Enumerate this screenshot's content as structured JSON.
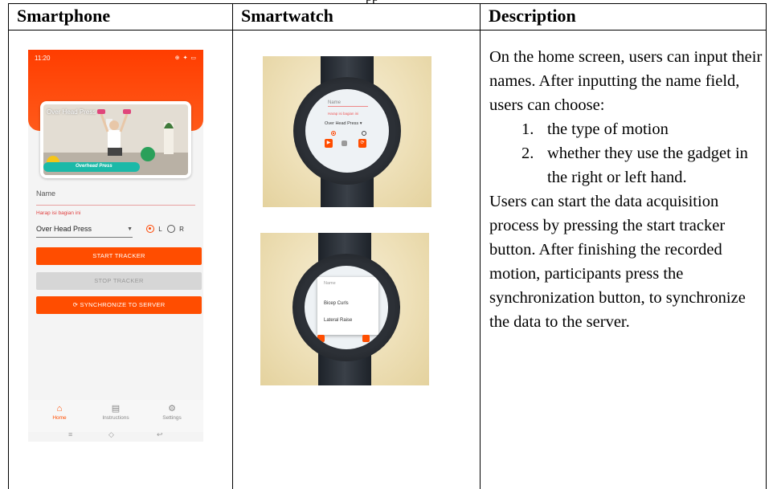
{
  "caption_fragment": "pp",
  "table": {
    "headers": [
      "Smartphone",
      "Smartwatch",
      "Description"
    ]
  },
  "phone": {
    "status_time": "11:20",
    "status_icons": "⊕ ✦ ▭",
    "motion_card_title": "Over Head Press",
    "motion_strip_label": "Overhead Press",
    "name_label": "Name",
    "name_error": "Harap isi bagian ini",
    "motion_select_value": "Over Head Press",
    "hand_left": "L",
    "hand_right": "R",
    "start_button": "START TRACKER",
    "stop_button": "STOP TRACKER",
    "sync_button": "SYNCHRONIZE TO SERVER",
    "nav": [
      {
        "label": "Home",
        "glyph": "⌂"
      },
      {
        "label": "Instructions",
        "glyph": "▤"
      },
      {
        "label": "Settings",
        "glyph": "⚙"
      }
    ],
    "system_nav": [
      "≡",
      "◇",
      "↩"
    ]
  },
  "watch1": {
    "name_label": "Name",
    "name_error": "Harap isi bagian ini",
    "motion_select": "Over Head Press ▾"
  },
  "watch2": {
    "name_label": "Name",
    "options": [
      "Bicep Curls",
      "Lateral Raise"
    ]
  },
  "description": {
    "intro": "On the home screen, users can input their names. After inputting the name field, users can choose:",
    "list": [
      {
        "num": "1.",
        "text": "the type of motion"
      },
      {
        "num": "2.",
        "text": "whether they use the gadget in the right or left hand."
      }
    ],
    "outro": "Users can start the data acquisition process by pressing the start tracker button. After finishing the recorded motion, participants press the synchronization button, to synchronize the data to the server."
  }
}
